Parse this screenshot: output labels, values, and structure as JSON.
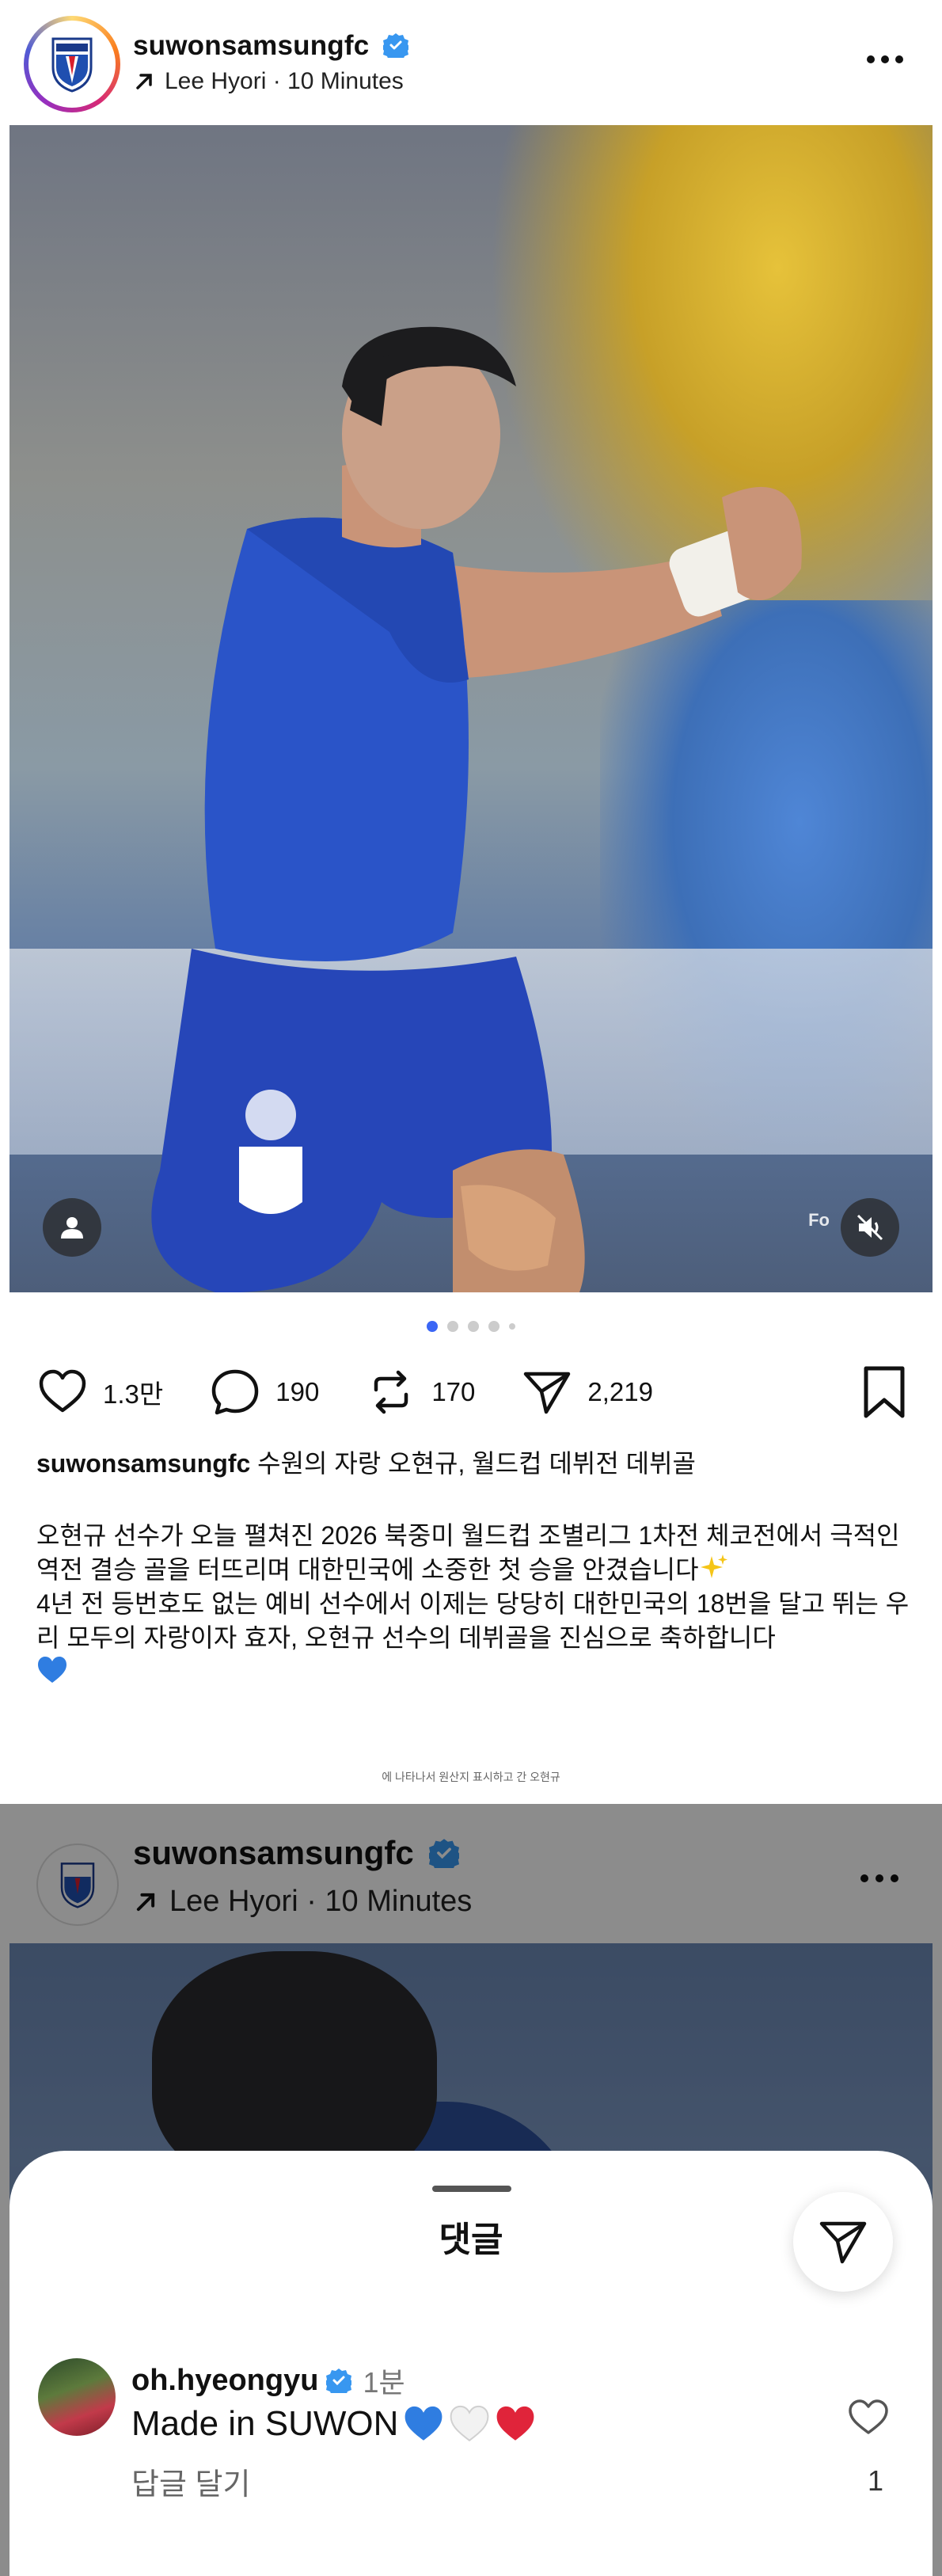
{
  "post": {
    "username": "suwonsamsungfc",
    "subline": "Lee Hyori · 10 Minutes",
    "watermark": "Fo"
  },
  "carousel": {
    "count": 5,
    "active": 0
  },
  "actions": {
    "likes": "1.3만",
    "comments": "190",
    "reposts": "170",
    "shares": "2,219"
  },
  "caption": {
    "username": "suwonsamsungfc",
    "headline": "수원의 자랑 오현규, 월드컵 데뷔전 데뷔골",
    "body_1": "오현규 선수가 오늘 펼쳐진 2026 북중미 월드컵 조별리그 1차전 체코전에서 극적인 역전 결승 골을 터뜨리며 대한민국에 소중한 첫 승을 안겼습니다",
    "body_2": "4년 전 등번호도 없는 예비 선수에서 이제는 당당히 대한민국의 18번을 달고 뛰는 우리 모두의 자랑이자 효자, 오현규 선수의 데뷔골을 진심으로 축하합니다",
    "translation_note": "에 나타나서 원산지 표시하고 간 오현규"
  },
  "next_post": {
    "username": "suwonsamsungfc",
    "subline": "Lee Hyori · 10 Minutes"
  },
  "comments_sheet": {
    "title": "댓글",
    "comment": {
      "username": "oh.hyeongyu",
      "time": "1분",
      "text": "Made in SUWON",
      "reply_label": "답글 달기",
      "like_count": "1"
    }
  },
  "colors": {
    "accent_blue": "#3b66f5",
    "verified": "#3897f0",
    "heart_blue": "#2f7de1",
    "heart_red": "#e0243a"
  },
  "icons": [
    "verified-icon",
    "arrow-ne-icon",
    "more-icon",
    "user-tag-icon",
    "mute-icon",
    "heart-icon",
    "comment-icon",
    "repost-icon",
    "send-icon",
    "bookmark-icon",
    "sparkle-icon",
    "blue-heart-icon",
    "white-heart-icon",
    "red-heart-icon"
  ]
}
